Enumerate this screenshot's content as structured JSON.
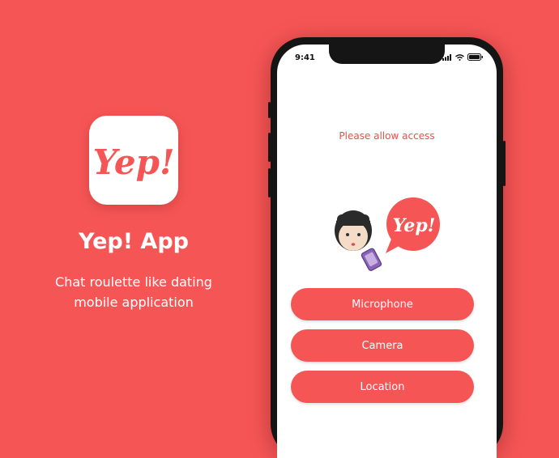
{
  "brand": {
    "logo_text": "Yep!",
    "app_name": "Yep! App",
    "tagline_line1": "Chat roulette like dating",
    "tagline_line2": "mobile application",
    "accent_color": "#f65555"
  },
  "phone": {
    "status_bar": {
      "time": "9:41",
      "icons": [
        "signal-icon",
        "wifi-icon",
        "battery-icon"
      ]
    },
    "screen": {
      "title": "Please allow access",
      "illustration_logo_text": "Yep!",
      "buttons": [
        "Microphone",
        "Camera",
        "Location"
      ]
    }
  }
}
